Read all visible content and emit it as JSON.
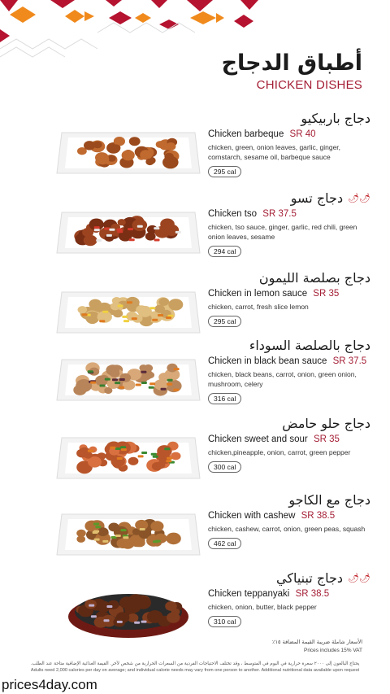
{
  "header": {
    "title_ar": "أطباق الدجاج",
    "title_en": "CHICKEN DISHES"
  },
  "items": [
    {
      "name_ar": "دجاج باربيكيو",
      "name_en": "Chicken barbeque",
      "price": "SR 40",
      "ingredients": "chicken, green, onion leaves, garlic, ginger, cornstarch, sesame oil, barbeque sauce",
      "calories": "295 cal",
      "spicy": false,
      "dish": "barbeque"
    },
    {
      "name_ar": "دجاج تسو",
      "name_en": "Chicken tso",
      "price": "SR 37.5",
      "ingredients": "chicken, tso sauce, ginger, garlic, red chili, green onion leaves, sesame",
      "calories": "294 cal",
      "spicy": true,
      "dish": "tso"
    },
    {
      "name_ar": "دجاج بصلصة الليمون",
      "name_en": "Chicken in lemon sauce",
      "price": "SR 35",
      "ingredients": "chicken, carrot, fresh slice lemon",
      "calories": "295 cal",
      "spicy": false,
      "dish": "lemon"
    },
    {
      "name_ar": "دجاج بالصلصة السوداء",
      "name_en": "Chicken in black bean sauce",
      "price": "SR 37.5",
      "ingredients": "chicken, black beans, carrot, onion, green onion, mushroom, celery",
      "calories": "316 cal",
      "spicy": false,
      "dish": "blackbean"
    },
    {
      "name_ar": "دجاج حلو حامض",
      "name_en": "Chicken sweet and sour",
      "price": "SR 35",
      "ingredients": "chicken,pineapple, onion, carrot, green pepper",
      "calories": "300 cal",
      "spicy": false,
      "dish": "sweetsour"
    },
    {
      "name_ar": "دجاج مع الكاجو",
      "name_en": "Chicken with cashew",
      "price": "SR 38.5",
      "ingredients": "chicken, cashew, carrot, onion, green peas, squash",
      "calories": "462 cal",
      "spicy": false,
      "dish": "cashew"
    },
    {
      "name_ar": "دجاج تبنياكي",
      "name_en": "Chicken teppanyaki",
      "price": "SR 38.5",
      "ingredients": "chicken, onion, butter, black pepper",
      "calories": "310 cal",
      "spicy": true,
      "dish": "teppanyaki"
    }
  ],
  "footer": {
    "vat_ar": "الأسعار شاملة ضريبة القيمة المضافة ١٥٪",
    "vat_en": "Prices includes 15% VAT",
    "note_ar": "يحتاج البالغون إلى ٢٠٠٠ سعرة حرارية في اليوم في المتوسط ​​، وقد تختلف الاحتياجات الفردية من السعرات الحرارية من شخص لآخر. القيمة الغذائية الإضافية متاحة عند الطلب.",
    "note_en": "Adults need 2,000 calories per day on average; and individual calorie needs may vary from one person to another. Additional nutritional data available upon request",
    "site": "prices4day.com"
  },
  "colors": {
    "accent": "#a41e35",
    "pattern_red": "#b5132f",
    "pattern_orange": "#f08a1c"
  }
}
